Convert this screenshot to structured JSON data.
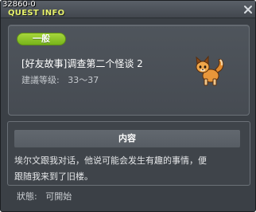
{
  "window": {
    "quest_id": "32860-0",
    "title": "QUEST INFO"
  },
  "quest": {
    "category": "一般",
    "name": "[好友故事]调查第二个怪谈 2",
    "level_label": "建議等级:",
    "level_range": "33～37"
  },
  "content": {
    "header": "内容",
    "lines": [
      "埃尔文跟我对话，他说可能会发生有趣的事情，便",
      "跟随我来到了旧楼。"
    ]
  },
  "status": {
    "label": "狀態:",
    "value": "可開始"
  },
  "icons": {
    "close": "close-icon",
    "npc": "fox-creature-icon"
  },
  "colors": {
    "title": "#e6f06a",
    "category_pill": "#8cc42a",
    "window_bg": "#3b4046"
  }
}
